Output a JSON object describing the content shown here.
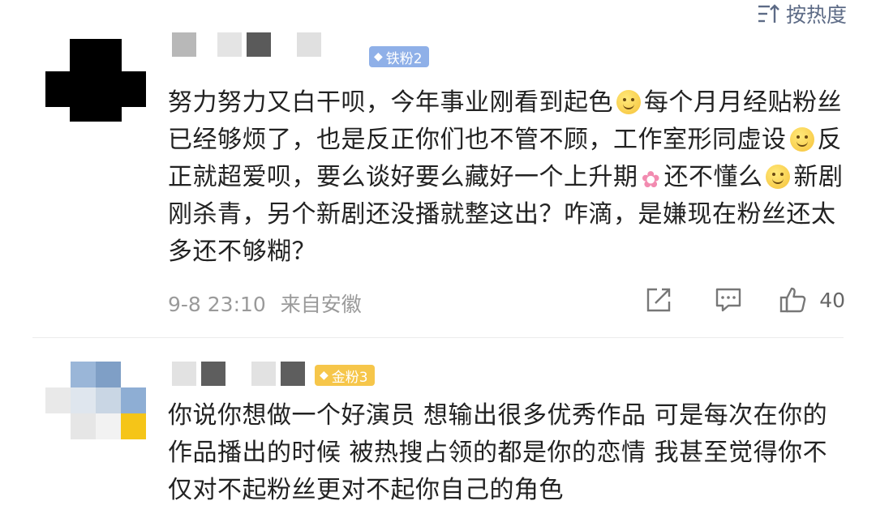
{
  "sort": {
    "label": "按热度",
    "icon": "sort-icon"
  },
  "comments": [
    {
      "badge": {
        "label": "铁粉2",
        "icon": "diamond-icon",
        "color": "#8fb0e8"
      },
      "segments": [
        "努力努力又白干呗，今年事业刚看到起色",
        "每个月月经贴粉丝已经够烦了，也是反正你们也不管不顾，工作室形同虚设",
        "反正就超爱呗，要么谈好要么藏好一个上升期",
        "还不懂么",
        "新剧刚杀青，另个新剧还没播就整这出？咋滴，是嫌现在粉丝还太多还不够糊？"
      ],
      "emojis": [
        "smile-emoji",
        "smile-emoji",
        "flower-emoji",
        "smile-emoji"
      ],
      "time": "9-8 23:10",
      "location": "来自安徽",
      "like_count": "40",
      "actions": [
        "share-icon",
        "reply-icon",
        "like-icon"
      ]
    },
    {
      "badge": {
        "label": "金粉3",
        "icon": "diamond-icon",
        "color": "#f6c64a"
      },
      "text": "你说你想做一个好演员 想输出很多优秀作品 可是每次在你的作品播出的时候 被热搜占领的都是你的恋情 我甚至觉得你不仅对不起粉丝更对不起你自己的角色"
    }
  ],
  "colors": {
    "accent": "#5d6b86",
    "meta": "#9a9a9a",
    "text": "#222222"
  }
}
